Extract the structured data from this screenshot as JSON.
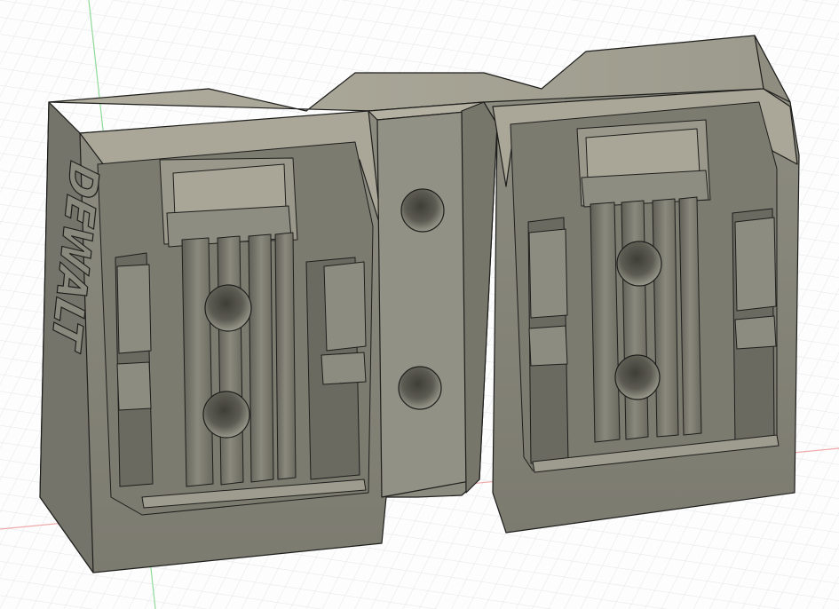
{
  "model": {
    "brand_text": "DEWALT",
    "face_color": "#858578",
    "top_color": "#a7a496",
    "side_color": "#6f6e63",
    "edge_color": "#1e1e1c",
    "grid_color": "#d9dbe0",
    "axis_x_color": "#f0a8a8",
    "axis_y_color": "#8fd99a"
  }
}
